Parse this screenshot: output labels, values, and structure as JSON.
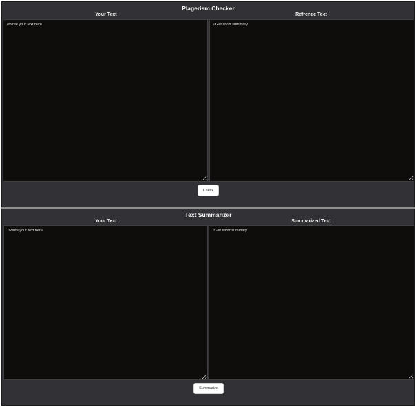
{
  "plagiarism": {
    "title": "Plagerism Checker",
    "left_label": "Your Text",
    "right_label": "Refrence Text",
    "left_placeholder": "//Write your text here",
    "right_placeholder": "//Get short summary",
    "button_label": "Check"
  },
  "summarizer": {
    "title": "Text Summarizer",
    "left_label": "Your Text",
    "right_label": "Summarized Text",
    "left_placeholder": "//Write your text here",
    "right_placeholder": "//Get short summary",
    "button_label": "Summarize"
  }
}
